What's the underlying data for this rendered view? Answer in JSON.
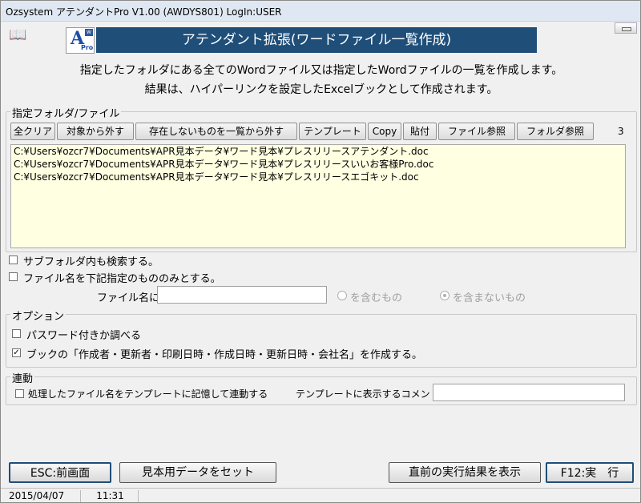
{
  "window": {
    "title": "Ozsystem アテンダントPro V1.00 (AWDYS801)  LogIn:USER"
  },
  "header": {
    "banner_title": "アテンダント拡張(ワードファイル一覧作成)",
    "logo_letter": "A",
    "logo_sub": "Pro",
    "logo_badge": "W",
    "description_line1": "指定したフォルダにある全てのWordファイル又は指定したWordファイルの一覧を作成します。",
    "description_line2": "結果は、ハイパーリンクを設定したExcelブックとして作成されます。"
  },
  "file_group": {
    "label": "指定フォルダ/ファイル",
    "buttons": {
      "clear_all": "全クリア",
      "exclude": "対象から外す",
      "exclude_missing": "存在しないものを一覧から外す",
      "template": "テンプレート",
      "copy": "Copy",
      "paste": "貼付",
      "file_browse": "ファイル参照",
      "folder_browse": "フォルダ参照"
    },
    "count": "3",
    "files": [
      "C:¥Users¥ozcr7¥Documents¥APR見本データ¥ワード見本¥プレスリリースアテンダント.doc",
      "C:¥Users¥ozcr7¥Documents¥APR見本データ¥ワード見本¥プレスリリースいいお客様Pro.doc",
      "C:¥Users¥ozcr7¥Documents¥APR見本データ¥ワード見本¥プレスリリースエゴキット.doc"
    ],
    "search_subfolders": "サブフォルダ内も検索する。",
    "filter_by_name": "ファイル名を下記指定のもののみとする。",
    "filename_label": "ファイル名に",
    "filename_value": "",
    "radio_include": "を含むもの",
    "radio_exclude": "を含まないもの"
  },
  "options": {
    "label": "オプション",
    "password_check": "パスワード付きか調べる",
    "book_properties": "ブックの「作成者・更新者・印刷日時・作成日時・更新日時・会社名」を作成する。",
    "book_properties_checked": true,
    "password_check_checked": false
  },
  "link": {
    "label": "連動",
    "remember_template": "処理したファイル名をテンプレートに記憶して連動する",
    "comment_label": "テンプレートに表示するコメント",
    "comment_value": ""
  },
  "footer": {
    "esc_button": "ESC:前画面",
    "sample_button": "見本用データをセット",
    "show_last_result": "直前の実行結果を表示",
    "execute_button": "F12:実　行"
  },
  "status": {
    "date": "2015/04/07",
    "time": "11:31"
  }
}
